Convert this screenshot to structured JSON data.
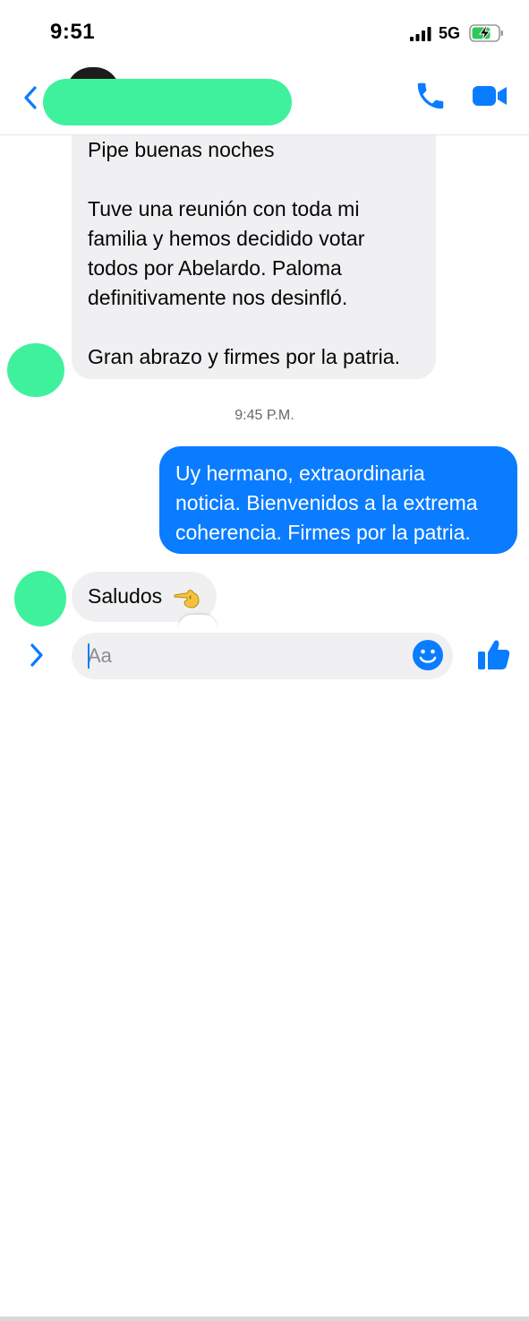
{
  "status_bar": {
    "time": "9:51",
    "network": "5G"
  },
  "header": {
    "contact_name": ""
  },
  "messages": {
    "incoming_main": [
      "Pipe buenas noches",
      "",
      "Tuve una reunión con toda mi",
      "familia y hemos decidido votar",
      "todos por Abelardo. Paloma",
      "definitivamente nos desinfló.",
      "",
      "Gran abrazo y firmes por la patria."
    ],
    "timestamp": "9:45 P.M.",
    "outgoing": [
      "Uy hermano, extraordinaria",
      "noticia. Bienvenidos a la extrema",
      "coherencia. Firmes por la patria."
    ],
    "incoming_last": "Saludos"
  },
  "composer": {
    "placeholder": "Aa"
  },
  "colors": {
    "accent": "#0a7cff",
    "incoming_bubble": "#f0f0f2",
    "redaction": "#3ff19c"
  },
  "icons": [
    "back-chevron-icon",
    "phone-icon",
    "video-icon",
    "expand-chevron-icon",
    "emoji-icon",
    "thumbs-up-icon",
    "pointing-hand-icon"
  ]
}
